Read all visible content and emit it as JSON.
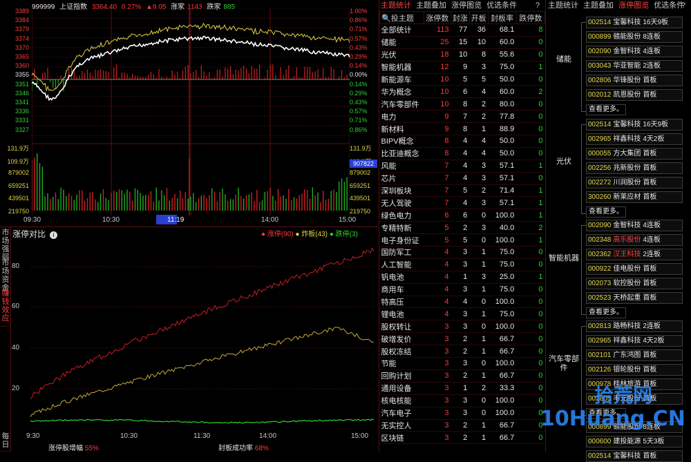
{
  "header": {
    "code": "999999",
    "name": "上证指数",
    "price": "3364.40",
    "pct": "0.27%",
    "change": "▲9.05",
    "up_label": "涨家",
    "up_count": "1143",
    "down_label": "跌家",
    "down_count": "885"
  },
  "price_axis_left": [
    "3389",
    "3384",
    "3379",
    "3374",
    "3370",
    "3365",
    "3360",
    "3355",
    "3351",
    "3346",
    "3341",
    "3336",
    "3331",
    "3327"
  ],
  "price_axis_right": [
    "1.00%",
    "0.86%",
    "0.71%",
    "0.57%",
    "0.43%",
    "0.29%",
    "0.14%",
    "0.00%",
    "0.14%",
    "0.29%",
    "0.43%",
    "0.57%",
    "0.71%",
    "0.86%"
  ],
  "vol_axis_left": [
    "131.9万",
    "109.9万",
    "879002",
    "659251",
    "439501",
    "219750"
  ],
  "vol_axis_right": [
    "131.9万",
    "109.9万",
    "879002",
    "659251",
    "439501",
    "219750"
  ],
  "vol_cursor": "907822",
  "time_axis": [
    "09:30",
    "10:30",
    "11:19",
    "14:00",
    "15:00"
  ],
  "lower": {
    "title": "涨停对比",
    "legend": [
      {
        "label": "涨停(90)",
        "color": "#ff3b3b"
      },
      {
        "label": "炸板(43)",
        "color": "#e5d447"
      },
      {
        "label": "跌停(3)",
        "color": "#2fd42f"
      }
    ],
    "yaxis": [
      "80",
      "60",
      "40",
      "20"
    ],
    "xaxis": [
      "9:30",
      "10:30",
      "11:30",
      "14:00",
      "15:00"
    ],
    "footer_left_label": "涨停股增幅",
    "footer_left_value": "55%",
    "footer_right_label": "封板成功率",
    "footer_right_value": "68%"
  },
  "side_tabs": [
    "市场强弱",
    "市场资金",
    "赚钱效应",
    "每日"
  ],
  "mid": {
    "tabs": [
      "主题统计",
      "主题叠加",
      "涨停图览",
      "优选条件",
      "?"
    ],
    "columns": [
      "投主题",
      "涨停数",
      "封涨",
      "开板",
      "封板率",
      "跌停数"
    ],
    "rows": [
      [
        "全部统计",
        "113",
        "77",
        "36",
        "68.1",
        "8"
      ],
      [
        "储能",
        "25",
        "15",
        "10",
        "60.0",
        "0"
      ],
      [
        "光伏",
        "18",
        "10",
        "8",
        "55.6",
        "0"
      ],
      [
        "智能机器",
        "12",
        "9",
        "3",
        "75.0",
        "1"
      ],
      [
        "新能源车",
        "10",
        "5",
        "5",
        "50.0",
        "0"
      ],
      [
        "华为概念",
        "10",
        "6",
        "4",
        "60.0",
        "2"
      ],
      [
        "汽车零部件",
        "10",
        "8",
        "2",
        "80.0",
        "0"
      ],
      [
        "电力",
        "9",
        "7",
        "2",
        "77.8",
        "0"
      ],
      [
        "新材料",
        "9",
        "8",
        "1",
        "88.9",
        "0"
      ],
      [
        "BIPV概念",
        "8",
        "4",
        "4",
        "50.0",
        "0"
      ],
      [
        "比亚迪概念",
        "8",
        "4",
        "4",
        "50.0",
        "0"
      ],
      [
        "风能",
        "7",
        "4",
        "3",
        "57.1",
        "1"
      ],
      [
        "芯片",
        "7",
        "4",
        "3",
        "57.1",
        "0"
      ],
      [
        "深圳板块",
        "7",
        "5",
        "2",
        "71.4",
        "1"
      ],
      [
        "无人驾驶",
        "7",
        "4",
        "3",
        "57.1",
        "1"
      ],
      [
        "绿色电力",
        "6",
        "6",
        "0",
        "100.0",
        "1"
      ],
      [
        "专精特新",
        "5",
        "2",
        "3",
        "40.0",
        "2"
      ],
      [
        "电子身份证",
        "5",
        "5",
        "0",
        "100.0",
        "1"
      ],
      [
        "国防军工",
        "4",
        "3",
        "1",
        "75.0",
        "0"
      ],
      [
        "人工智能",
        "4",
        "3",
        "1",
        "75.0",
        "0"
      ],
      [
        "钒电池",
        "4",
        "1",
        "3",
        "25.0",
        "1"
      ],
      [
        "商用车",
        "4",
        "3",
        "1",
        "75.0",
        "0"
      ],
      [
        "特高压",
        "4",
        "4",
        "0",
        "100.0",
        "0"
      ],
      [
        "锂电池",
        "4",
        "3",
        "1",
        "75.0",
        "0"
      ],
      [
        "股权转让",
        "3",
        "3",
        "0",
        "100.0",
        "0"
      ],
      [
        "破增发价",
        "3",
        "2",
        "1",
        "66.7",
        "0"
      ],
      [
        "股权冻结",
        "3",
        "2",
        "1",
        "66.7",
        "0"
      ],
      [
        "节能",
        "3",
        "3",
        "0",
        "100.0",
        "0"
      ],
      [
        "回购计划",
        "3",
        "2",
        "1",
        "66.7",
        "0"
      ],
      [
        "通用设备",
        "3",
        "1",
        "2",
        "33.3",
        "0"
      ],
      [
        "核电核能",
        "3",
        "3",
        "0",
        "100.0",
        "0"
      ],
      [
        "汽车电子",
        "3",
        "3",
        "0",
        "100.0",
        "0"
      ],
      [
        "无实控人",
        "3",
        "2",
        "1",
        "66.7",
        "0"
      ],
      [
        "区块链",
        "3",
        "2",
        "1",
        "66.7",
        "0"
      ]
    ]
  },
  "right": {
    "tabs": [
      "主题统计",
      "主题叠加",
      "涨停图览",
      "优选条件",
      "?"
    ],
    "more_label": "查看更多。",
    "groups": [
      {
        "label": "储能",
        "stocks": [
          {
            "code": "002514",
            "name": "宝馨科技",
            "tag": "16天9板",
            "red": false
          },
          {
            "code": "000899",
            "name": "赣能股份",
            "tag": "8连板",
            "red": false
          },
          {
            "code": "002090",
            "name": "金智科技",
            "tag": "4连板",
            "red": false
          },
          {
            "code": "003043",
            "name": "华亚智能",
            "tag": "2连板",
            "red": false
          },
          {
            "code": "002806",
            "name": "华锋股份",
            "tag": "首板",
            "red": false
          },
          {
            "code": "002012",
            "name": "凯恩股份",
            "tag": "首板",
            "red": false
          }
        ]
      },
      {
        "label": "光伏",
        "stocks": [
          {
            "code": "002514",
            "name": "宝馨科技",
            "tag": "16天9板",
            "red": false
          },
          {
            "code": "002965",
            "name": "祥鑫科技",
            "tag": "4天2板",
            "red": false
          },
          {
            "code": "000055",
            "name": "方大集团",
            "tag": "首板",
            "red": false
          },
          {
            "code": "002256",
            "name": "兆新股份",
            "tag": "首板",
            "red": false
          },
          {
            "code": "002272",
            "name": "川润股份",
            "tag": "首板",
            "red": false
          },
          {
            "code": "300260",
            "name": "新莱应材",
            "tag": "首板",
            "red": false
          }
        ]
      },
      {
        "label": "智能机器",
        "stocks": [
          {
            "code": "002090",
            "name": "金智科技",
            "tag": "4连板",
            "red": false
          },
          {
            "code": "002348",
            "name": "高乐股份",
            "tag": "4连板",
            "red": true
          },
          {
            "code": "002362",
            "name": "汉王科技",
            "tag": "2连板",
            "red": true
          },
          {
            "code": "000922",
            "name": "佳电股份",
            "tag": "首板",
            "red": false
          },
          {
            "code": "002073",
            "name": "软控股份",
            "tag": "首板",
            "red": false
          },
          {
            "code": "002523",
            "name": "天桥起重",
            "tag": "首板",
            "red": false
          }
        ]
      },
      {
        "label": "汽车零部件",
        "stocks": [
          {
            "code": "002813",
            "name": "路畅科技",
            "tag": "2连板",
            "red": false
          },
          {
            "code": "002965",
            "name": "祥鑫科技",
            "tag": "4天2板",
            "red": false
          },
          {
            "code": "002101",
            "name": "广东鸿图",
            "tag": "首板",
            "red": false
          },
          {
            "code": "002126",
            "name": "银轮股份",
            "tag": "首板",
            "red": false
          },
          {
            "code": "000978",
            "name": "桂林旅游",
            "tag": "首板",
            "red": false
          },
          {
            "code": "002805",
            "name": "丰元股份",
            "tag": "首板",
            "red": false
          }
        ]
      },
      {
        "label": "",
        "stocks": [
          {
            "code": "000899",
            "name": "赣能股份",
            "tag": "8连板",
            "red": false
          },
          {
            "code": "000600",
            "name": "建投能源",
            "tag": "5天3板",
            "red": false
          },
          {
            "code": "002514",
            "name": "宝馨科技",
            "tag": "首板",
            "red": false
          }
        ]
      }
    ]
  },
  "watermark": {
    "line1": "拾荒网",
    "line2": "10Huang.CN"
  }
}
